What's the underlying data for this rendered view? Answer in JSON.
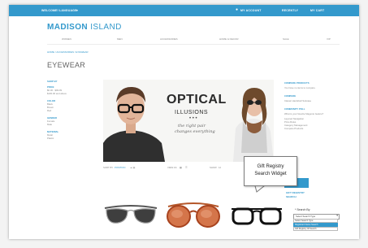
{
  "topbar": {
    "welcome": "WELCOME!",
    "language": "LANGUAGE",
    "account": "MY ACCOUNT",
    "recent": "RECENTLY",
    "cart": "MY CART"
  },
  "logo": {
    "part1": "MADISON",
    "part2": "ISLAND"
  },
  "nav": {
    "items": [
      "WOMEN",
      "MEN",
      "ACCESSORIES",
      "HOME & DECOR",
      "SALE",
      "VIP"
    ]
  },
  "breadcrumb": "HOME / ACCESSORIES / EYEWEAR",
  "page_title": "EYEWEAR",
  "left_nav": {
    "heading": "SHOP BY",
    "groups": [
      {
        "title": "PRICE",
        "items": [
          "$0.00 - $99.99",
          "$100.00 and above"
        ]
      },
      {
        "title": "COLOR",
        "items": [
          "Black",
          "Brown",
          "Red"
        ]
      },
      {
        "title": "GENDER",
        "items": [
          "Female",
          "Male"
        ]
      },
      {
        "title": "MATERIAL",
        "items": [
          "Metal",
          "Plastic"
        ]
      }
    ]
  },
  "banner": {
    "title": "OPTICAL",
    "subtitle": "ILLUSIONS",
    "dots": "• • •",
    "tagline1": "the right pair",
    "tagline2": "changes everything"
  },
  "toolbar": {
    "sort_label": "SORT BY",
    "sort_value": "POSITION",
    "view_label": "VIEW AS",
    "show_label": "SHOW",
    "show_value": "12"
  },
  "sidebar": {
    "compare_heading": "COMPARE PRODUCTS",
    "compare_text": "You have no items to compare.",
    "compare_heading2": "COMPARE",
    "compare_item": "Classic Hardshell Suitcase",
    "community_heading": "COMMUNITY POLL",
    "community_question": "What is your favorite Magento feature?",
    "poll_options": [
      "Layered Navigation",
      "Price Rules",
      "Category Management",
      "Compare Products"
    ]
  },
  "callout": {
    "line1": "Gift Registry",
    "line2": "Search Widget"
  },
  "gift_registry": {
    "heading1": "GIFT REGISTRY",
    "heading2": "SEARCH",
    "search_label": "* Search By",
    "selected": "Select Search Type",
    "options": [
      "Select Search Type",
      "Registrant Name Search",
      "Gift Registry ID Search"
    ]
  },
  "colors": {
    "accent": "#3399cc",
    "text": "#636363",
    "page_bg": "#ffffff"
  },
  "products": [
    "aviator-sunglasses",
    "round-oversized-sunglasses",
    "black-frame-eyeglasses"
  ]
}
